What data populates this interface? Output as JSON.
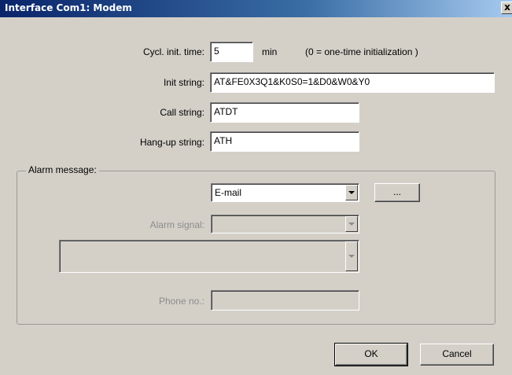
{
  "window": {
    "title": "Interface Com1: Modem",
    "close_label": "x"
  },
  "form": {
    "cycl_init_label": "Cycl. init. time:",
    "cycl_init_value": "5",
    "cycl_init_unit": "min",
    "cycl_init_hint": "(0 = one-time initialization )",
    "init_string_label": "Init string:",
    "init_string_value": "AT&FE0X3Q1&K0S0=1&D0&W0&Y0",
    "call_string_label": "Call string:",
    "call_string_value": "ATDT",
    "hangup_label": "Hang-up string:",
    "hangup_value": "ATH"
  },
  "alarm": {
    "group_label": "Alarm message:",
    "type_selected": "E-mail",
    "more_button": "...",
    "signal_label": "Alarm signal:",
    "signal_value": "",
    "wide_combo_value": "",
    "phone_label": "Phone no.:",
    "phone_value": ""
  },
  "buttons": {
    "ok": "OK",
    "cancel": "Cancel"
  }
}
